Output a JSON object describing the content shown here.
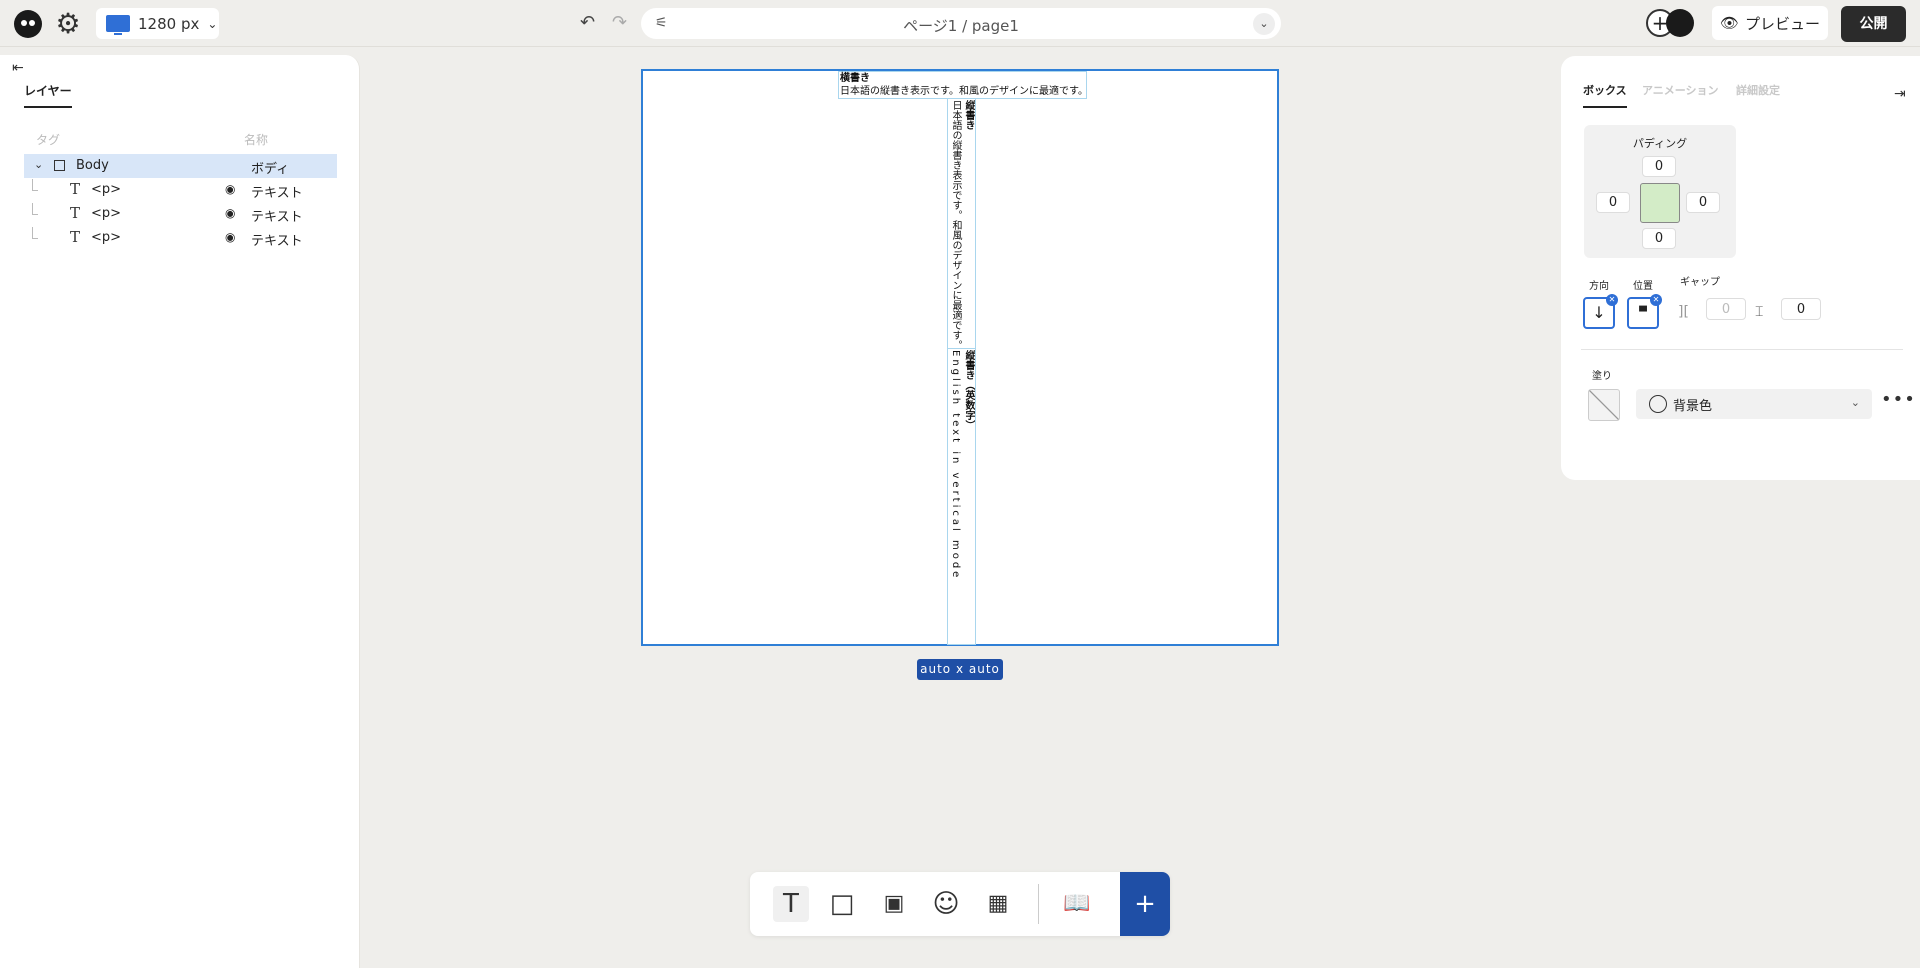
{
  "topbar": {
    "device_width": "1280 px",
    "page_name": "ページ1 / page1",
    "preview_label": "プレビュー",
    "publish_label": "公開"
  },
  "layers": {
    "tab_label": "レイヤー",
    "col_tag": "タグ",
    "col_name": "名称",
    "rows": [
      {
        "tag": "Body",
        "name": "ボディ"
      },
      {
        "tag": "<p>",
        "name": "テキスト"
      },
      {
        "tag": "<p>",
        "name": "テキスト"
      },
      {
        "tag": "<p>",
        "name": "テキスト"
      }
    ]
  },
  "canvas": {
    "block1": {
      "heading": "横書き",
      "body": "日本語の縦書き表示です。和風のデザインに最適です。"
    },
    "block2": {
      "heading": "縦書き",
      "body": "日本語の縦書き表示です。和風のデザインに最適です。"
    },
    "block3": {
      "heading": "縦書き（英数字）",
      "body": "English text in vertical mode"
    },
    "size_badge": "auto x auto"
  },
  "props": {
    "tabs": [
      "ボックス",
      "アニメーション",
      "詳細設定"
    ],
    "padding_label": "パディング",
    "padding": {
      "top": "0",
      "right": "0",
      "bottom": "0",
      "left": "0"
    },
    "direction_label": "方向",
    "position_label": "位置",
    "gap_label": "ギャップ",
    "gap_col": "0",
    "gap_row": "0",
    "fill_label": "塗り",
    "bg_label": "背景色",
    "colors": {
      "accent": "#2f6fd6",
      "padding_center": "#d3ecc7",
      "publish": "#2b2b2b"
    }
  },
  "toolbar": {
    "icons": [
      "text-icon",
      "box-icon",
      "image-icon",
      "emoji-icon",
      "grid-icon",
      "book-icon",
      "plus-icon"
    ]
  }
}
